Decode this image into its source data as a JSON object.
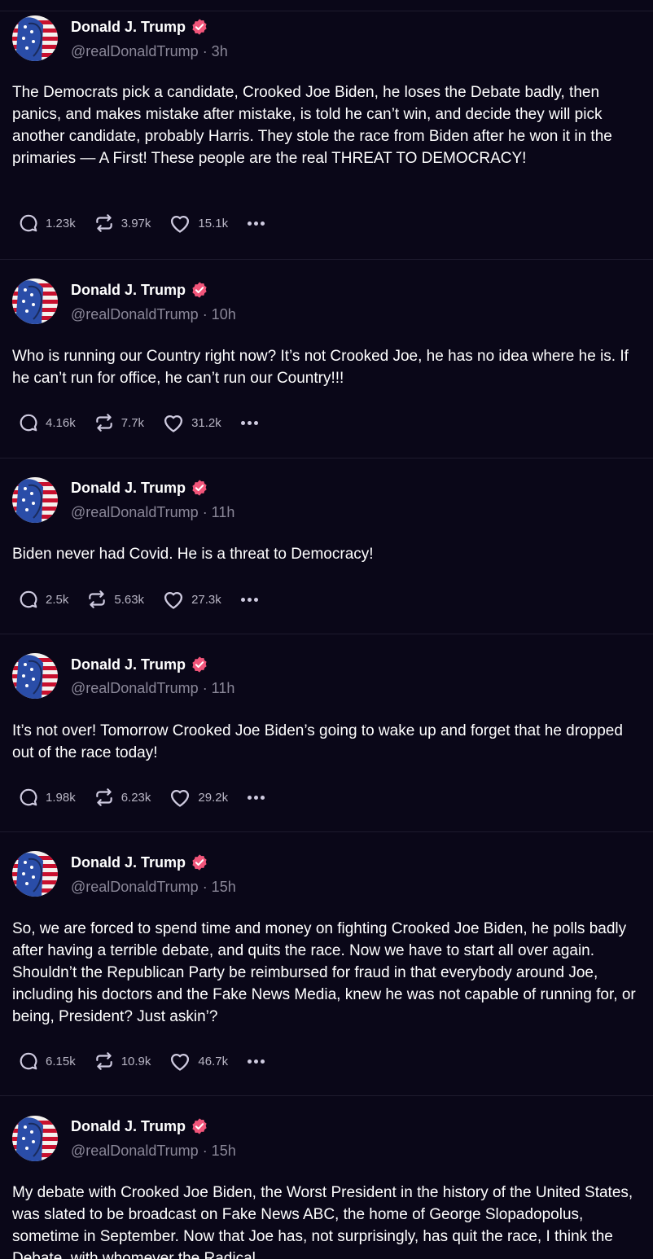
{
  "colors": {
    "background": "#0a0718",
    "divider": "#1e1b2e",
    "verified_badge": "#f1557a",
    "muted_text": "#8a8798",
    "count_text": "#b8b5c4"
  },
  "icons": {
    "reply": "reply-icon",
    "retruth": "retruth-icon",
    "like": "heart-icon",
    "more": "more-icon",
    "verified": "verified-badge-icon"
  },
  "posts": [
    {
      "name": "Donald J. Trump",
      "handle": "@realDonaldTrump",
      "time": "· 3h",
      "text": "The Democrats pick a candidate, Crooked Joe Biden, he loses the Debate badly, then panics, and makes mistake after mistake, is told he can’t win, and decide they will pick another candidate, probably Harris. They stole the race from Biden after he won it in the primaries — A First! These people are the real THREAT TO DEMOCRACY!",
      "replies": "1.23k",
      "retruths": "3.97k",
      "likes": "15.1k"
    },
    {
      "name": "Donald J. Trump",
      "handle": "@realDonaldTrump",
      "time": "· 10h",
      "text": "Who is running our Country right now? It’s not Crooked Joe, he has no idea where he is. If he can’t run for office, he can’t run our Country!!!",
      "replies": "4.16k",
      "retruths": "7.7k",
      "likes": "31.2k"
    },
    {
      "name": "Donald J. Trump",
      "handle": "@realDonaldTrump",
      "time": "· 11h",
      "text": "Biden never had Covid. He is a threat to Democracy!",
      "replies": "2.5k",
      "retruths": "5.63k",
      "likes": "27.3k"
    },
    {
      "name": "Donald J. Trump",
      "handle": "@realDonaldTrump",
      "time": "· 11h",
      "text": "It’s not over! Tomorrow Crooked Joe Biden’s going to wake up and forget that he dropped out of the race today!",
      "replies": "1.98k",
      "retruths": "6.23k",
      "likes": "29.2k"
    },
    {
      "name": "Donald J. Trump",
      "handle": "@realDonaldTrump",
      "time": "· 15h",
      "text": "So, we are forced to spend time and money on fighting Crooked Joe Biden, he polls badly after having a terrible debate, and quits the race. Now we have to start all over again. Shouldn’t the Republican Party be reimbursed for fraud in that everybody around Joe, including his doctors and the Fake News Media, knew he was not capable of running for, or being, President?  Just askin’?",
      "replies": "6.15k",
      "retruths": "10.9k",
      "likes": "46.7k"
    },
    {
      "name": "Donald J. Trump",
      "handle": "@realDonaldTrump",
      "time": "· 15h",
      "text": "My debate with Crooked Joe Biden, the Worst President in the history of the United States, was slated to be broadcast on Fake News ABC, the home of George Slopadopolus, sometime in September. Now that Joe has, not surprisingly, has quit the race, I think the Debate, with whomever the Radical"
    }
  ]
}
